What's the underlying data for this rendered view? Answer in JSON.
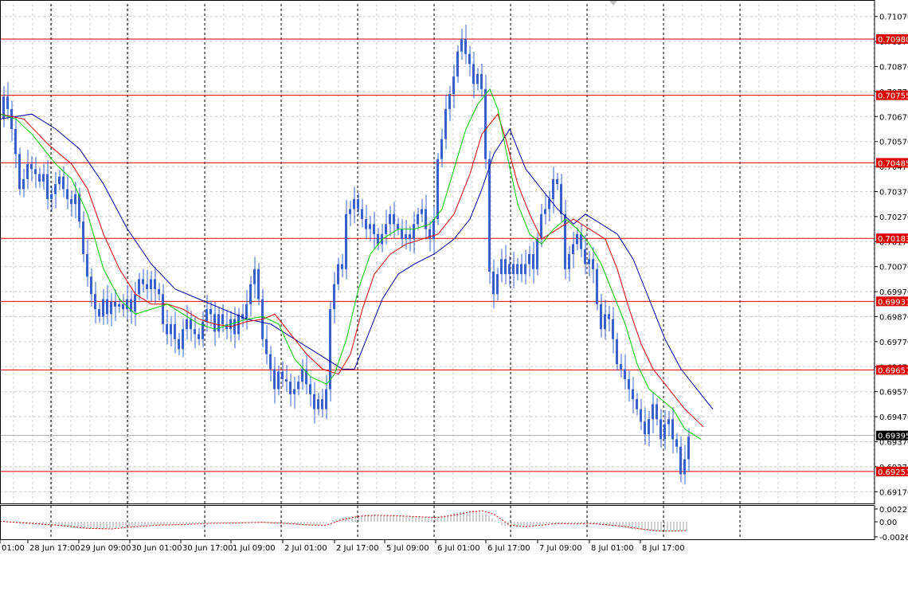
{
  "chart_data": {
    "type": "candlestick",
    "symbol_pair_quote": "forex",
    "colors": {
      "background": "#ffffff",
      "candles": "#3a5fcd",
      "ma_fast": "#00c800",
      "ma_mid": "#dc0000",
      "ma_slow": "#0000a0",
      "levels": "#e00000",
      "macd_hist": "#a0a0a0",
      "macd_signal": "#c80000",
      "grid": "#c8c8c8"
    },
    "price_axis": {
      "range": [
        0.6912,
        0.7112
      ],
      "ticks": [
        "0.71070",
        "0.70970",
        "0.70870",
        "0.70770",
        "0.70670",
        "0.70570",
        "0.70470",
        "0.70370",
        "0.70270",
        "0.70170",
        "0.70070",
        "0.69970",
        "0.69870",
        "0.69770",
        "0.69670",
        "0.69570",
        "0.69470",
        "0.69370",
        "0.69270",
        "0.69170"
      ]
    },
    "time_axis": {
      "labels": [
        "01:00",
        "28 Jun 17:00",
        "29 Jun 09:00",
        "30 Jun 01:00",
        "30 Jun 17:00",
        "1 Jul 09:00",
        "2 Jul 01:00",
        "2 Jul 17:00",
        "5 Jul 09:00",
        "6 Jul 01:00",
        "6 Jul 17:00",
        "7 Jul 09:00",
        "8 Jul 01:00",
        "8 Jul 17:00"
      ]
    },
    "horizontal_levels": [
      "0.70980",
      "0.70755",
      "0.70485",
      "0.70183",
      "0.69931",
      "0.69657",
      "0.69251"
    ],
    "current_price": "0.69395",
    "indicator": {
      "name": "MACD",
      "ticks": [
        "0.002227",
        "0.00",
        "-0.00260"
      ],
      "range": [
        -0.0029,
        0.0025
      ]
    },
    "price_path": [
      [
        0,
        0.7066
      ],
      [
        5,
        0.7075
      ],
      [
        10,
        0.707
      ],
      [
        15,
        0.7062
      ],
      [
        20,
        0.7052
      ],
      [
        25,
        0.7038
      ],
      [
        30,
        0.7042
      ],
      [
        35,
        0.7048
      ],
      [
        40,
        0.7046
      ],
      [
        45,
        0.7044
      ],
      [
        50,
        0.7041
      ],
      [
        55,
        0.7044
      ],
      [
        60,
        0.7034
      ],
      [
        65,
        0.7036
      ],
      [
        70,
        0.704
      ],
      [
        75,
        0.7043
      ],
      [
        80,
        0.7038
      ],
      [
        85,
        0.7034
      ],
      [
        90,
        0.7032
      ],
      [
        95,
        0.7036
      ],
      [
        100,
        0.7025
      ],
      [
        105,
        0.7012
      ],
      [
        110,
        0.7003
      ],
      [
        115,
        0.6996
      ],
      [
        120,
        0.699
      ],
      [
        125,
        0.6987
      ],
      [
        130,
        0.6994
      ],
      [
        135,
        0.6988
      ],
      [
        140,
        0.6993
      ],
      [
        145,
        0.6991
      ],
      [
        150,
        0.6992
      ],
      [
        155,
        0.699
      ],
      [
        160,
        0.6994
      ],
      [
        165,
        0.6989
      ],
      [
        170,
        0.6996
      ],
      [
        175,
        0.7002
      ],
      [
        180,
        0.7
      ],
      [
        185,
        0.6998
      ],
      [
        190,
        0.7002
      ],
      [
        195,
        0.6998
      ],
      [
        200,
        0.6996
      ],
      [
        205,
        0.6984
      ],
      [
        210,
        0.698
      ],
      [
        215,
        0.6984
      ],
      [
        220,
        0.6978
      ],
      [
        225,
        0.6974
      ],
      [
        230,
        0.6982
      ],
      [
        235,
        0.6986
      ],
      [
        240,
        0.6982
      ],
      [
        245,
        0.698
      ],
      [
        250,
        0.6978
      ],
      [
        255,
        0.6985
      ],
      [
        260,
        0.699
      ],
      [
        265,
        0.6988
      ],
      [
        270,
        0.6981
      ],
      [
        275,
        0.6988
      ],
      [
        280,
        0.6984
      ],
      [
        285,
        0.6982
      ],
      [
        290,
        0.6986
      ],
      [
        295,
        0.698
      ],
      [
        300,
        0.6988
      ],
      [
        305,
        0.6986
      ],
      [
        310,
        0.6992
      ],
      [
        315,
        0.7
      ],
      [
        320,
        0.7006
      ],
      [
        325,
        0.6994
      ],
      [
        330,
        0.6978
      ],
      [
        335,
        0.6972
      ],
      [
        340,
        0.6966
      ],
      [
        345,
        0.6958
      ],
      [
        350,
        0.6965
      ],
      [
        355,
        0.6962
      ],
      [
        360,
        0.6961
      ],
      [
        365,
        0.6956
      ],
      [
        370,
        0.6958
      ],
      [
        375,
        0.6961
      ],
      [
        380,
        0.6966
      ],
      [
        385,
        0.696
      ],
      [
        390,
        0.6956
      ],
      [
        395,
        0.695
      ],
      [
        400,
        0.6954
      ],
      [
        405,
        0.695
      ],
      [
        410,
        0.6958
      ],
      [
        415,
        0.699
      ],
      [
        420,
        0.7
      ],
      [
        425,
        0.7008
      ],
      [
        430,
        0.7006
      ],
      [
        435,
        0.7028
      ],
      [
        440,
        0.703
      ],
      [
        445,
        0.7034
      ],
      [
        450,
        0.703
      ],
      [
        455,
        0.7026
      ],
      [
        460,
        0.7022
      ],
      [
        465,
        0.7024
      ],
      [
        470,
        0.702
      ],
      [
        475,
        0.7016
      ],
      [
        480,
        0.702
      ],
      [
        485,
        0.7024
      ],
      [
        490,
        0.7028
      ],
      [
        495,
        0.7024
      ],
      [
        500,
        0.7022
      ],
      [
        505,
        0.7018
      ],
      [
        510,
        0.702
      ],
      [
        515,
        0.7018
      ],
      [
        520,
        0.7024
      ],
      [
        525,
        0.7028
      ],
      [
        530,
        0.703
      ],
      [
        535,
        0.7022
      ],
      [
        540,
        0.7018
      ],
      [
        545,
        0.7026
      ],
      [
        550,
        0.705
      ],
      [
        555,
        0.7058
      ],
      [
        560,
        0.707
      ],
      [
        565,
        0.7076
      ],
      [
        570,
        0.7083
      ],
      [
        575,
        0.7093
      ],
      [
        580,
        0.7098
      ],
      [
        585,
        0.7092
      ],
      [
        590,
        0.7088
      ],
      [
        595,
        0.708
      ],
      [
        600,
        0.7084
      ],
      [
        605,
        0.7078
      ],
      [
        610,
        0.705
      ],
      [
        615,
        0.7005
      ],
      [
        620,
        0.6996
      ],
      [
        625,
        0.7004
      ],
      [
        630,
        0.701
      ],
      [
        635,
        0.7004
      ],
      [
        640,
        0.7008
      ],
      [
        645,
        0.7004
      ],
      [
        650,
        0.7008
      ],
      [
        655,
        0.7004
      ],
      [
        660,
        0.7008
      ],
      [
        665,
        0.7012
      ],
      [
        670,
        0.7006
      ],
      [
        675,
        0.7018
      ],
      [
        680,
        0.7028
      ],
      [
        685,
        0.703
      ],
      [
        690,
        0.7034
      ],
      [
        695,
        0.7042
      ],
      [
        700,
        0.704
      ],
      [
        705,
        0.7028
      ],
      [
        710,
        0.7006
      ],
      [
        715,
        0.7012
      ],
      [
        720,
        0.7016
      ],
      [
        725,
        0.702
      ],
      [
        730,
        0.7014
      ],
      [
        735,
        0.7008
      ],
      [
        740,
        0.701
      ],
      [
        745,
        0.7006
      ],
      [
        750,
        0.6992
      ],
      [
        755,
        0.6982
      ],
      [
        760,
        0.6988
      ],
      [
        765,
        0.6986
      ],
      [
        770,
        0.6978
      ],
      [
        775,
        0.6968
      ],
      [
        780,
        0.6966
      ],
      [
        785,
        0.6962
      ],
      [
        790,
        0.6958
      ],
      [
        795,
        0.6954
      ],
      [
        800,
        0.695
      ],
      [
        805,
        0.6945
      ],
      [
        810,
        0.694
      ],
      [
        815,
        0.6946
      ],
      [
        820,
        0.6952
      ],
      [
        825,
        0.6946
      ],
      [
        830,
        0.6938
      ],
      [
        835,
        0.6944
      ],
      [
        840,
        0.6946
      ],
      [
        845,
        0.6938
      ],
      [
        850,
        0.6935
      ],
      [
        855,
        0.6924
      ],
      [
        860,
        0.693
      ],
      [
        865,
        0.6939
      ]
    ],
    "ma_fast_path": [
      [
        0,
        0.7068
      ],
      [
        20,
        0.7066
      ],
      [
        40,
        0.706
      ],
      [
        70,
        0.7048
      ],
      [
        90,
        0.7042
      ],
      [
        110,
        0.7028
      ],
      [
        130,
        0.7006
      ],
      [
        150,
        0.6994
      ],
      [
        170,
        0.6988
      ],
      [
        190,
        0.699
      ],
      [
        210,
        0.6992
      ],
      [
        230,
        0.6988
      ],
      [
        250,
        0.6984
      ],
      [
        270,
        0.6982
      ],
      [
        290,
        0.6984
      ],
      [
        310,
        0.6986
      ],
      [
        330,
        0.6987
      ],
      [
        350,
        0.6984
      ],
      [
        370,
        0.697
      ],
      [
        390,
        0.6963
      ],
      [
        410,
        0.696
      ],
      [
        420,
        0.6964
      ],
      [
        435,
        0.6978
      ],
      [
        450,
        0.6998
      ],
      [
        465,
        0.7012
      ],
      [
        480,
        0.7018
      ],
      [
        500,
        0.7022
      ],
      [
        520,
        0.7022
      ],
      [
        540,
        0.7024
      ],
      [
        555,
        0.703
      ],
      [
        570,
        0.7046
      ],
      [
        585,
        0.7062
      ],
      [
        600,
        0.7072
      ],
      [
        615,
        0.7078
      ],
      [
        625,
        0.707
      ],
      [
        635,
        0.7054
      ],
      [
        650,
        0.7032
      ],
      [
        665,
        0.702
      ],
      [
        680,
        0.7016
      ],
      [
        695,
        0.7022
      ],
      [
        710,
        0.7026
      ],
      [
        725,
        0.7022
      ],
      [
        740,
        0.7016
      ],
      [
        755,
        0.7008
      ],
      [
        770,
        0.6996
      ],
      [
        785,
        0.6984
      ],
      [
        800,
        0.6968
      ],
      [
        815,
        0.6958
      ],
      [
        830,
        0.6954
      ],
      [
        845,
        0.695
      ],
      [
        860,
        0.6942
      ],
      [
        880,
        0.6938
      ]
    ],
    "ma_mid_path": [
      [
        0,
        0.7068
      ],
      [
        30,
        0.7066
      ],
      [
        60,
        0.7056
      ],
      [
        90,
        0.7048
      ],
      [
        110,
        0.7038
      ],
      [
        130,
        0.702
      ],
      [
        150,
        0.7006
      ],
      [
        170,
        0.6996
      ],
      [
        190,
        0.6992
      ],
      [
        210,
        0.6992
      ],
      [
        230,
        0.699
      ],
      [
        250,
        0.6986
      ],
      [
        270,
        0.6984
      ],
      [
        290,
        0.6983
      ],
      [
        310,
        0.6985
      ],
      [
        330,
        0.6986
      ],
      [
        345,
        0.6988
      ],
      [
        365,
        0.698
      ],
      [
        385,
        0.6972
      ],
      [
        405,
        0.6966
      ],
      [
        425,
        0.6964
      ],
      [
        440,
        0.6972
      ],
      [
        455,
        0.699
      ],
      [
        470,
        0.7004
      ],
      [
        490,
        0.7012
      ],
      [
        510,
        0.7016
      ],
      [
        530,
        0.7018
      ],
      [
        550,
        0.702
      ],
      [
        570,
        0.7028
      ],
      [
        590,
        0.7044
      ],
      [
        605,
        0.706
      ],
      [
        625,
        0.7068
      ],
      [
        635,
        0.7058
      ],
      [
        650,
        0.704
      ],
      [
        665,
        0.7028
      ],
      [
        680,
        0.7018
      ],
      [
        700,
        0.7022
      ],
      [
        720,
        0.7026
      ],
      [
        740,
        0.7022
      ],
      [
        760,
        0.7018
      ],
      [
        775,
        0.7006
      ],
      [
        790,
        0.699
      ],
      [
        805,
        0.6976
      ],
      [
        820,
        0.6966
      ],
      [
        840,
        0.6958
      ],
      [
        860,
        0.695
      ],
      [
        883,
        0.6943
      ]
    ],
    "ma_slow_path": [
      [
        0,
        0.7066
      ],
      [
        40,
        0.7068
      ],
      [
        70,
        0.7062
      ],
      [
        100,
        0.7054
      ],
      [
        130,
        0.704
      ],
      [
        160,
        0.7022
      ],
      [
        190,
        0.7008
      ],
      [
        220,
        0.6998
      ],
      [
        250,
        0.6994
      ],
      [
        280,
        0.699
      ],
      [
        310,
        0.6986
      ],
      [
        340,
        0.6984
      ],
      [
        370,
        0.6978
      ],
      [
        400,
        0.6972
      ],
      [
        430,
        0.6966
      ],
      [
        445,
        0.6966
      ],
      [
        460,
        0.6978
      ],
      [
        480,
        0.6994
      ],
      [
        500,
        0.7004
      ],
      [
        520,
        0.7008
      ],
      [
        545,
        0.7012
      ],
      [
        570,
        0.7018
      ],
      [
        590,
        0.7026
      ],
      [
        605,
        0.7038
      ],
      [
        620,
        0.7052
      ],
      [
        640,
        0.7062
      ],
      [
        660,
        0.7046
      ],
      [
        680,
        0.7038
      ],
      [
        700,
        0.703
      ],
      [
        720,
        0.7024
      ],
      [
        735,
        0.7028
      ],
      [
        755,
        0.7024
      ],
      [
        775,
        0.702
      ],
      [
        795,
        0.701
      ],
      [
        815,
        0.6994
      ],
      [
        835,
        0.6978
      ],
      [
        855,
        0.6966
      ],
      [
        875,
        0.6958
      ],
      [
        895,
        0.695
      ]
    ],
    "macd_path": [
      [
        0,
        0.0001
      ],
      [
        40,
        -0.0003
      ],
      [
        80,
        -0.0007
      ],
      [
        110,
        -0.0012
      ],
      [
        140,
        -0.0013
      ],
      [
        170,
        -0.0009
      ],
      [
        200,
        -0.0006
      ],
      [
        230,
        -0.0005
      ],
      [
        260,
        -0.0003
      ],
      [
        300,
        -0.0002
      ],
      [
        330,
        -0.0001
      ],
      [
        360,
        -0.0003
      ],
      [
        390,
        -0.0006
      ],
      [
        410,
        -0.0006
      ],
      [
        430,
        0.0004
      ],
      [
        450,
        0.001
      ],
      [
        470,
        0.0012
      ],
      [
        500,
        0.0011
      ],
      [
        530,
        0.0009
      ],
      [
        550,
        0.0008
      ],
      [
        570,
        0.0012
      ],
      [
        590,
        0.0018
      ],
      [
        605,
        0.002
      ],
      [
        620,
        0.0014
      ],
      [
        640,
        -0.0006
      ],
      [
        660,
        -0.0009
      ],
      [
        680,
        -0.0006
      ],
      [
        700,
        -0.0003
      ],
      [
        720,
        -0.0004
      ],
      [
        740,
        -0.0003
      ],
      [
        760,
        -0.0005
      ],
      [
        780,
        -0.0008
      ],
      [
        800,
        -0.0012
      ],
      [
        820,
        -0.0016
      ],
      [
        840,
        -0.0017
      ],
      [
        862,
        -0.0016
      ]
    ]
  }
}
